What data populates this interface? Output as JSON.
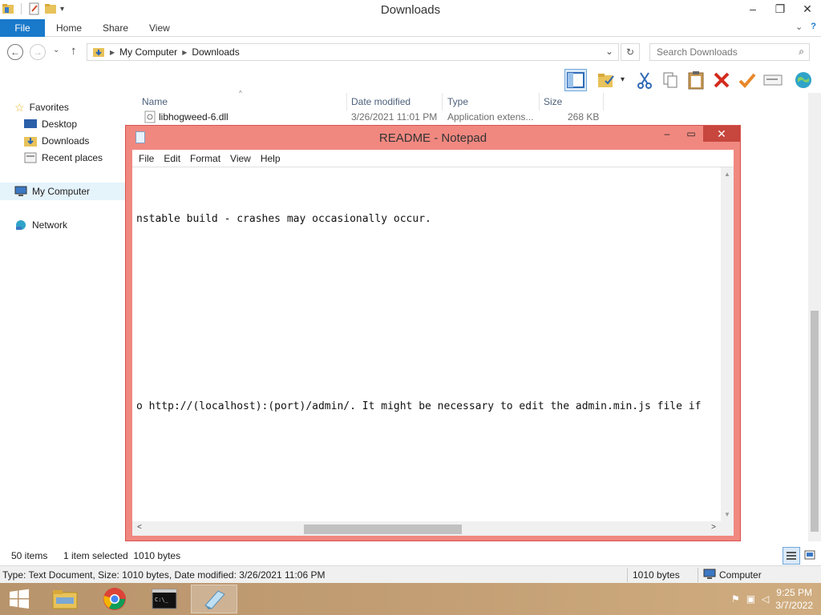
{
  "explorer": {
    "title": "Downloads",
    "window_controls": [
      "–",
      "❐",
      "✕"
    ],
    "ribbon_tabs": [
      "File",
      "Home",
      "Share",
      "View"
    ],
    "ribbon_right": [
      "⌄",
      "?"
    ],
    "nav_buttons": [
      "←",
      "→",
      "⌄",
      "↑"
    ],
    "address": {
      "crumbs": [
        "My Computer",
        "Downloads"
      ],
      "dropdown": "⌄",
      "refresh": "↻"
    },
    "search": {
      "placeholder": "Search Downloads"
    },
    "toolbar_icons": [
      "layout-icon",
      "folder-options-icon",
      "cut-icon",
      "copy-icon",
      "paste-icon",
      "delete-icon",
      "checkmark-icon",
      "rename-icon",
      "globe-icon"
    ],
    "navpane": {
      "favorites": "Favorites",
      "desktop": "Desktop",
      "downloads": "Downloads",
      "recent": "Recent places",
      "computer": "My Computer",
      "network": "Network"
    },
    "columns": [
      "Name",
      "Date modified",
      "Type",
      "Size"
    ],
    "rows": [
      {
        "name": "libhogweed-6.dll",
        "date": "3/26/2021 11:01 PM",
        "type": "Application extens...",
        "size": "268 KB"
      }
    ],
    "status": {
      "count": "50 items",
      "selected": "1 item selected  1010 bytes"
    },
    "details_bar": {
      "info": "Type: Text Document, Size: 1010 bytes, Date modified: 3/26/2021 11:06 PM",
      "size": "1010 bytes",
      "location": "Computer"
    }
  },
  "notepad": {
    "title": "README - Notepad",
    "menu": [
      "File",
      "Edit",
      "Format",
      "View",
      "Help"
    ],
    "lines": [
      "nstable build - crashes may occasionally occur.",
      "o http://(localhost):(port)/admin/. It might be necessary to edit the admin.min.js file if"
    ],
    "hscroll_position": 0.32
  },
  "taskbar": {
    "apps": [
      "windows-start-icon",
      "file-explorer-icon",
      "chrome-icon",
      "cmd-icon",
      "notepad-icon"
    ],
    "clock": {
      "time": "9:25 PM",
      "date": "3/7/2022"
    }
  },
  "colors": {
    "notepad_frame": "#f08880",
    "accent": "#1979ca",
    "taskbar": "#c49f75"
  }
}
